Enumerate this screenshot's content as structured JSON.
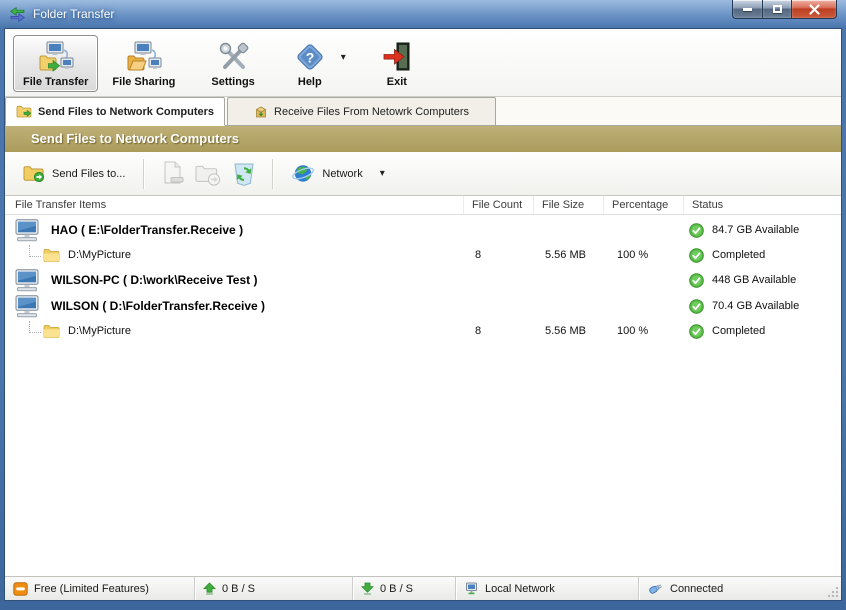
{
  "window": {
    "title": "Folder Transfer"
  },
  "icons": {
    "caret_down": "▾",
    "question_mark": "?"
  },
  "toolbar": {
    "items": [
      {
        "id": "file-transfer",
        "label": "File Transfer",
        "selected": true
      },
      {
        "id": "file-sharing",
        "label": "File Sharing",
        "selected": false
      },
      {
        "id": "settings",
        "label": "Settings",
        "selected": false
      },
      {
        "id": "help",
        "label": "Help",
        "selected": false,
        "has_dropdown": true
      },
      {
        "id": "exit",
        "label": "Exit",
        "selected": false
      }
    ]
  },
  "tabs": [
    {
      "label": "Send Files to Network Computers",
      "active": true
    },
    {
      "label": "Receive Files From Netowrk Computers",
      "active": false
    }
  ],
  "section_header": "Send Files to Network Computers",
  "subtoolbar": {
    "send_files_button": "Send Files to...",
    "network_button": "Network"
  },
  "list": {
    "columns": [
      "File Transfer Items",
      "File Count",
      "File Size",
      "Percentage",
      "Status"
    ],
    "rows": [
      {
        "type": "computer",
        "name": "HAO ( E:\\FolderTransfer.Receive )",
        "file_count": "",
        "file_size": "",
        "percentage": "",
        "status": "84.7 GB Available"
      },
      {
        "type": "folder",
        "name": "D:\\MyPicture",
        "file_count": "8",
        "file_size": "5.56 MB",
        "percentage": "100 %",
        "status": "Completed"
      },
      {
        "type": "computer",
        "name": "WILSON-PC ( D:\\work\\Receive Test )",
        "file_count": "",
        "file_size": "",
        "percentage": "",
        "status": "448 GB Available"
      },
      {
        "type": "computer",
        "name": "WILSON ( D:\\FolderTransfer.Receive )",
        "file_count": "",
        "file_size": "",
        "percentage": "",
        "status": "70.4 GB Available"
      },
      {
        "type": "folder",
        "name": "D:\\MyPicture",
        "file_count": "8",
        "file_size": "5.56 MB",
        "percentage": "100 %",
        "status": "Completed"
      }
    ]
  },
  "status_bar": {
    "license": "Free (Limited Features)",
    "upload_speed": "0 B / S",
    "download_speed": "0 B / S",
    "network": "Local Network",
    "connection": "Connected"
  },
  "colors": {
    "header_gold": "#b3a569",
    "title_bar_blue": "#4a76ad",
    "status_green": "#46a33c",
    "accent_red": "#c1472c"
  }
}
